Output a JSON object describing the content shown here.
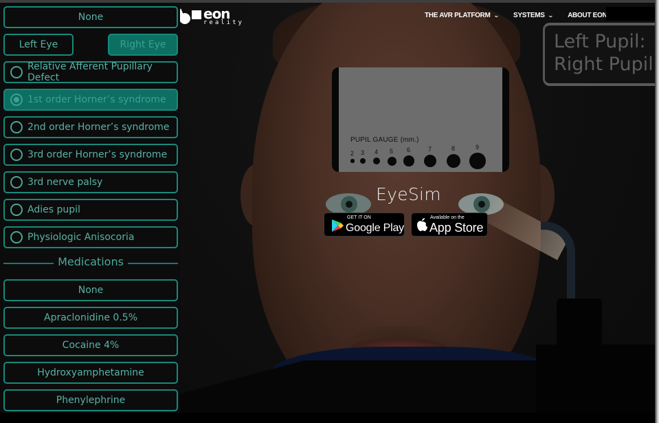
{
  "header": {
    "logo": {
      "name": "eon",
      "subtitle": "reality"
    },
    "nav": [
      {
        "label": "THE AVR PLATFORM",
        "icon": "chevron-down-icon"
      },
      {
        "label": "SYSTEMS",
        "icon": "chevron-down-icon"
      },
      {
        "label": "ABOUT EON",
        "icon": "chevron-down-icon"
      }
    ]
  },
  "panel": {
    "top_none_label": "None",
    "eye_selector": {
      "left_label": "Left Eye",
      "right_label": "Right Eye",
      "selected": "Right Eye"
    },
    "conditions": [
      {
        "label": "Relative Afferent Pupillary Defect",
        "selected": false
      },
      {
        "label": "1st order Horner’s syndrome",
        "selected": true
      },
      {
        "label": "2nd order Horner’s syndrome",
        "selected": false
      },
      {
        "label": "3rd order Horner’s syndrome",
        "selected": false
      },
      {
        "label": "3rd nerve palsy",
        "selected": false
      },
      {
        "label": "Adies pupil",
        "selected": false
      },
      {
        "label": "Physiologic Anisocoria",
        "selected": false
      }
    ],
    "medications_heading": "Medications",
    "medications": [
      {
        "label": "None"
      },
      {
        "label": "Apraclonidine 0.5%"
      },
      {
        "label": "Cocaine 4%"
      },
      {
        "label": "Hydroxyamphetamine"
      },
      {
        "label": "Phenylephrine"
      }
    ]
  },
  "scene": {
    "gauge": {
      "title": "PUPIL GAUGE (mm.)",
      "sizes": [
        "2",
        "3",
        "4",
        "5",
        "6",
        "7",
        "8",
        "9"
      ]
    },
    "readout": {
      "left": "Left Pupil:",
      "right": "Right Pupil"
    },
    "app_title": "EyeSim",
    "google_play": {
      "small": "GET IT ON",
      "big": "Google Play"
    },
    "app_store": {
      "small": "Available on the",
      "big": "App Store"
    }
  },
  "colors": {
    "accent": "#178a7c",
    "accent_text": "#58b3a6",
    "active_bg": "#0d6e62",
    "background": "#0c0c0c"
  }
}
